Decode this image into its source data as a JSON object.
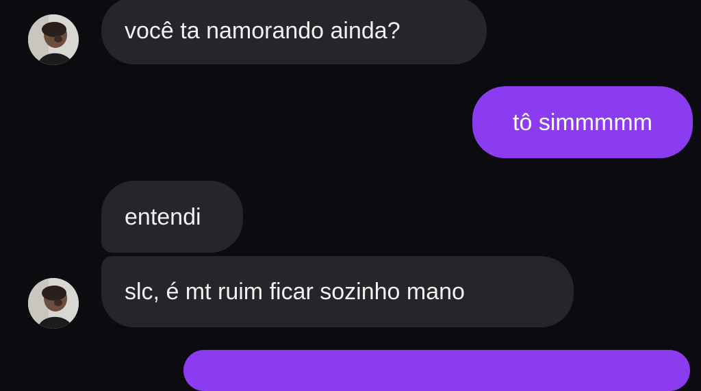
{
  "messages": [
    {
      "direction": "incoming",
      "text": "você ta namorando ainda?"
    },
    {
      "direction": "outgoing",
      "text": "tô simmmmm"
    },
    {
      "direction": "incoming",
      "text": "entendi"
    },
    {
      "direction": "incoming",
      "text": "slc, é mt ruim ficar sozinho mano"
    },
    {
      "direction": "outgoing",
      "text": ""
    }
  ],
  "colors": {
    "background": "#0b0b10",
    "incoming_bubble": "#26262a",
    "outgoing_bubble": "#8b3cf0",
    "text": "#ffffff"
  },
  "icons": {
    "avatar": "contact-avatar"
  }
}
